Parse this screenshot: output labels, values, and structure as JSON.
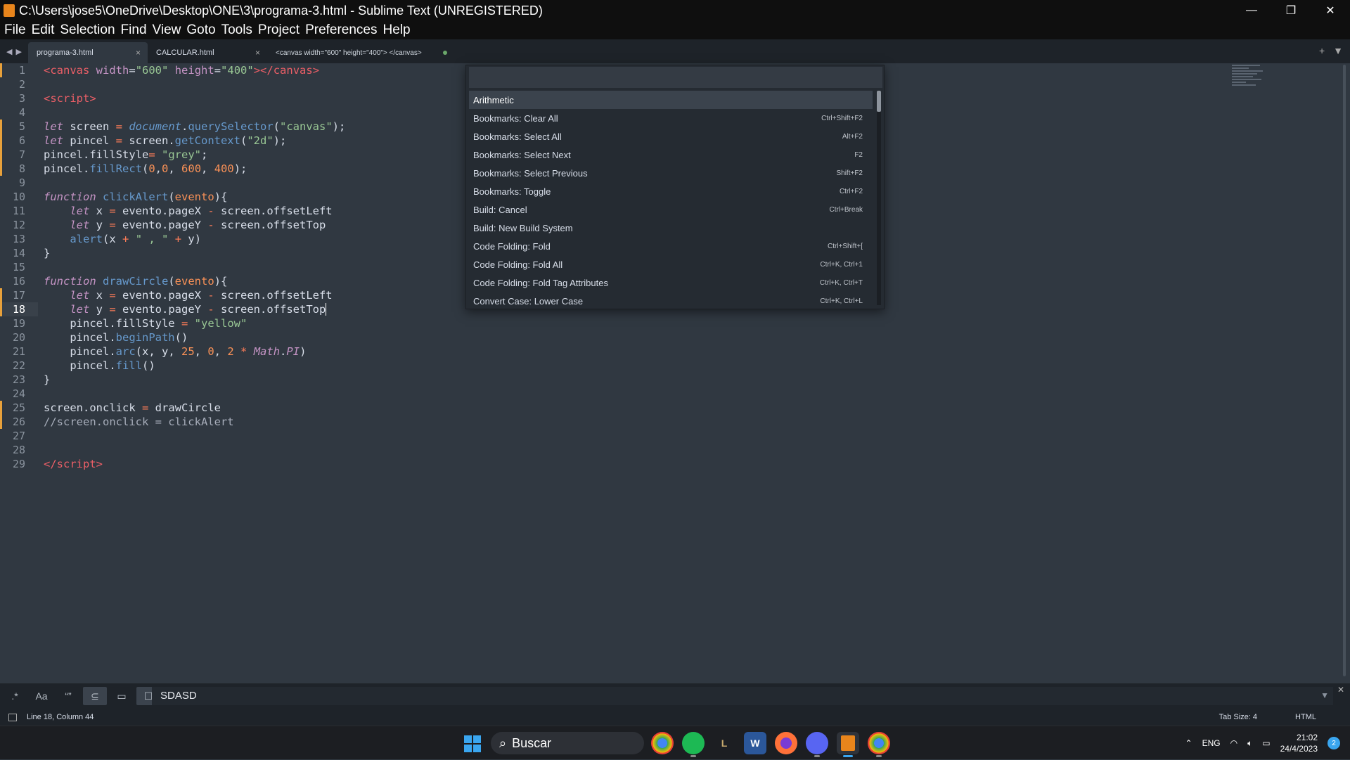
{
  "window": {
    "title": "C:\\Users\\jose5\\OneDrive\\Desktop\\ONE\\3\\programa-3.html - Sublime Text (UNREGISTERED)"
  },
  "menu": [
    "File",
    "Edit",
    "Selection",
    "Find",
    "View",
    "Goto",
    "Tools",
    "Project",
    "Preferences",
    "Help"
  ],
  "tabs": [
    {
      "label": "programa-3.html",
      "close": "×"
    },
    {
      "label": "CALCULAR.html",
      "close": "×"
    },
    {
      "label": "<canvas width=\"600\" height=\"400\"> </canvas>"
    }
  ],
  "editor": {
    "current_line": 18,
    "modified_lines": [
      1,
      5,
      6,
      7,
      8,
      17,
      18,
      25,
      26
    ],
    "line_numbers": [
      "1",
      "2",
      "3",
      "4",
      "5",
      "6",
      "7",
      "8",
      "9",
      "10",
      "11",
      "12",
      "13",
      "14",
      "15",
      "16",
      "17",
      "18",
      "19",
      "20",
      "21",
      "22",
      "23",
      "24",
      "25",
      "26",
      "27",
      "28",
      "29"
    ]
  },
  "palette": {
    "search_value": "",
    "items": [
      {
        "label": "Arithmetic",
        "shortcut": ""
      },
      {
        "label": "Bookmarks: Clear All",
        "shortcut": "Ctrl+Shift+F2"
      },
      {
        "label": "Bookmarks: Select All",
        "shortcut": "Alt+F2"
      },
      {
        "label": "Bookmarks: Select Next",
        "shortcut": "F2"
      },
      {
        "label": "Bookmarks: Select Previous",
        "shortcut": "Shift+F2"
      },
      {
        "label": "Bookmarks: Toggle",
        "shortcut": "Ctrl+F2"
      },
      {
        "label": "Build: Cancel",
        "shortcut": "Ctrl+Break"
      },
      {
        "label": "Build: New Build System",
        "shortcut": ""
      },
      {
        "label": "Code Folding: Fold",
        "shortcut": "Ctrl+Shift+["
      },
      {
        "label": "Code Folding: Fold All",
        "shortcut": "Ctrl+K, Ctrl+1"
      },
      {
        "label": "Code Folding: Fold Tag Attributes",
        "shortcut": "Ctrl+K, Ctrl+T"
      },
      {
        "label": "Convert Case: Lower Case",
        "shortcut": "Ctrl+K, Ctrl+L"
      }
    ]
  },
  "findbar": {
    "buttons": [
      ".*",
      "Aa",
      "“”",
      "⊆",
      "▭",
      "☐"
    ],
    "query": "SDASD"
  },
  "status": {
    "position": "Line 18, Column 44",
    "tab_size": "Tab Size: 4",
    "syntax": "HTML"
  },
  "taskbar": {
    "search_label": "Buscar",
    "apps": [
      "chrome-icon",
      "spotify-icon",
      "lol-icon",
      "word-icon",
      "firefox-icon",
      "discord-icon",
      "sublime-icon",
      "chrome-profile-icon"
    ],
    "language": "ENG",
    "time": "21:02",
    "date": "24/4/2023",
    "notifications": "2"
  },
  "colors": {
    "editor_bg": "#303841",
    "keyword": "#c594c5",
    "function": "#6699cc",
    "string": "#99c794",
    "number": "#f99157",
    "tag": "#ec5f67"
  }
}
